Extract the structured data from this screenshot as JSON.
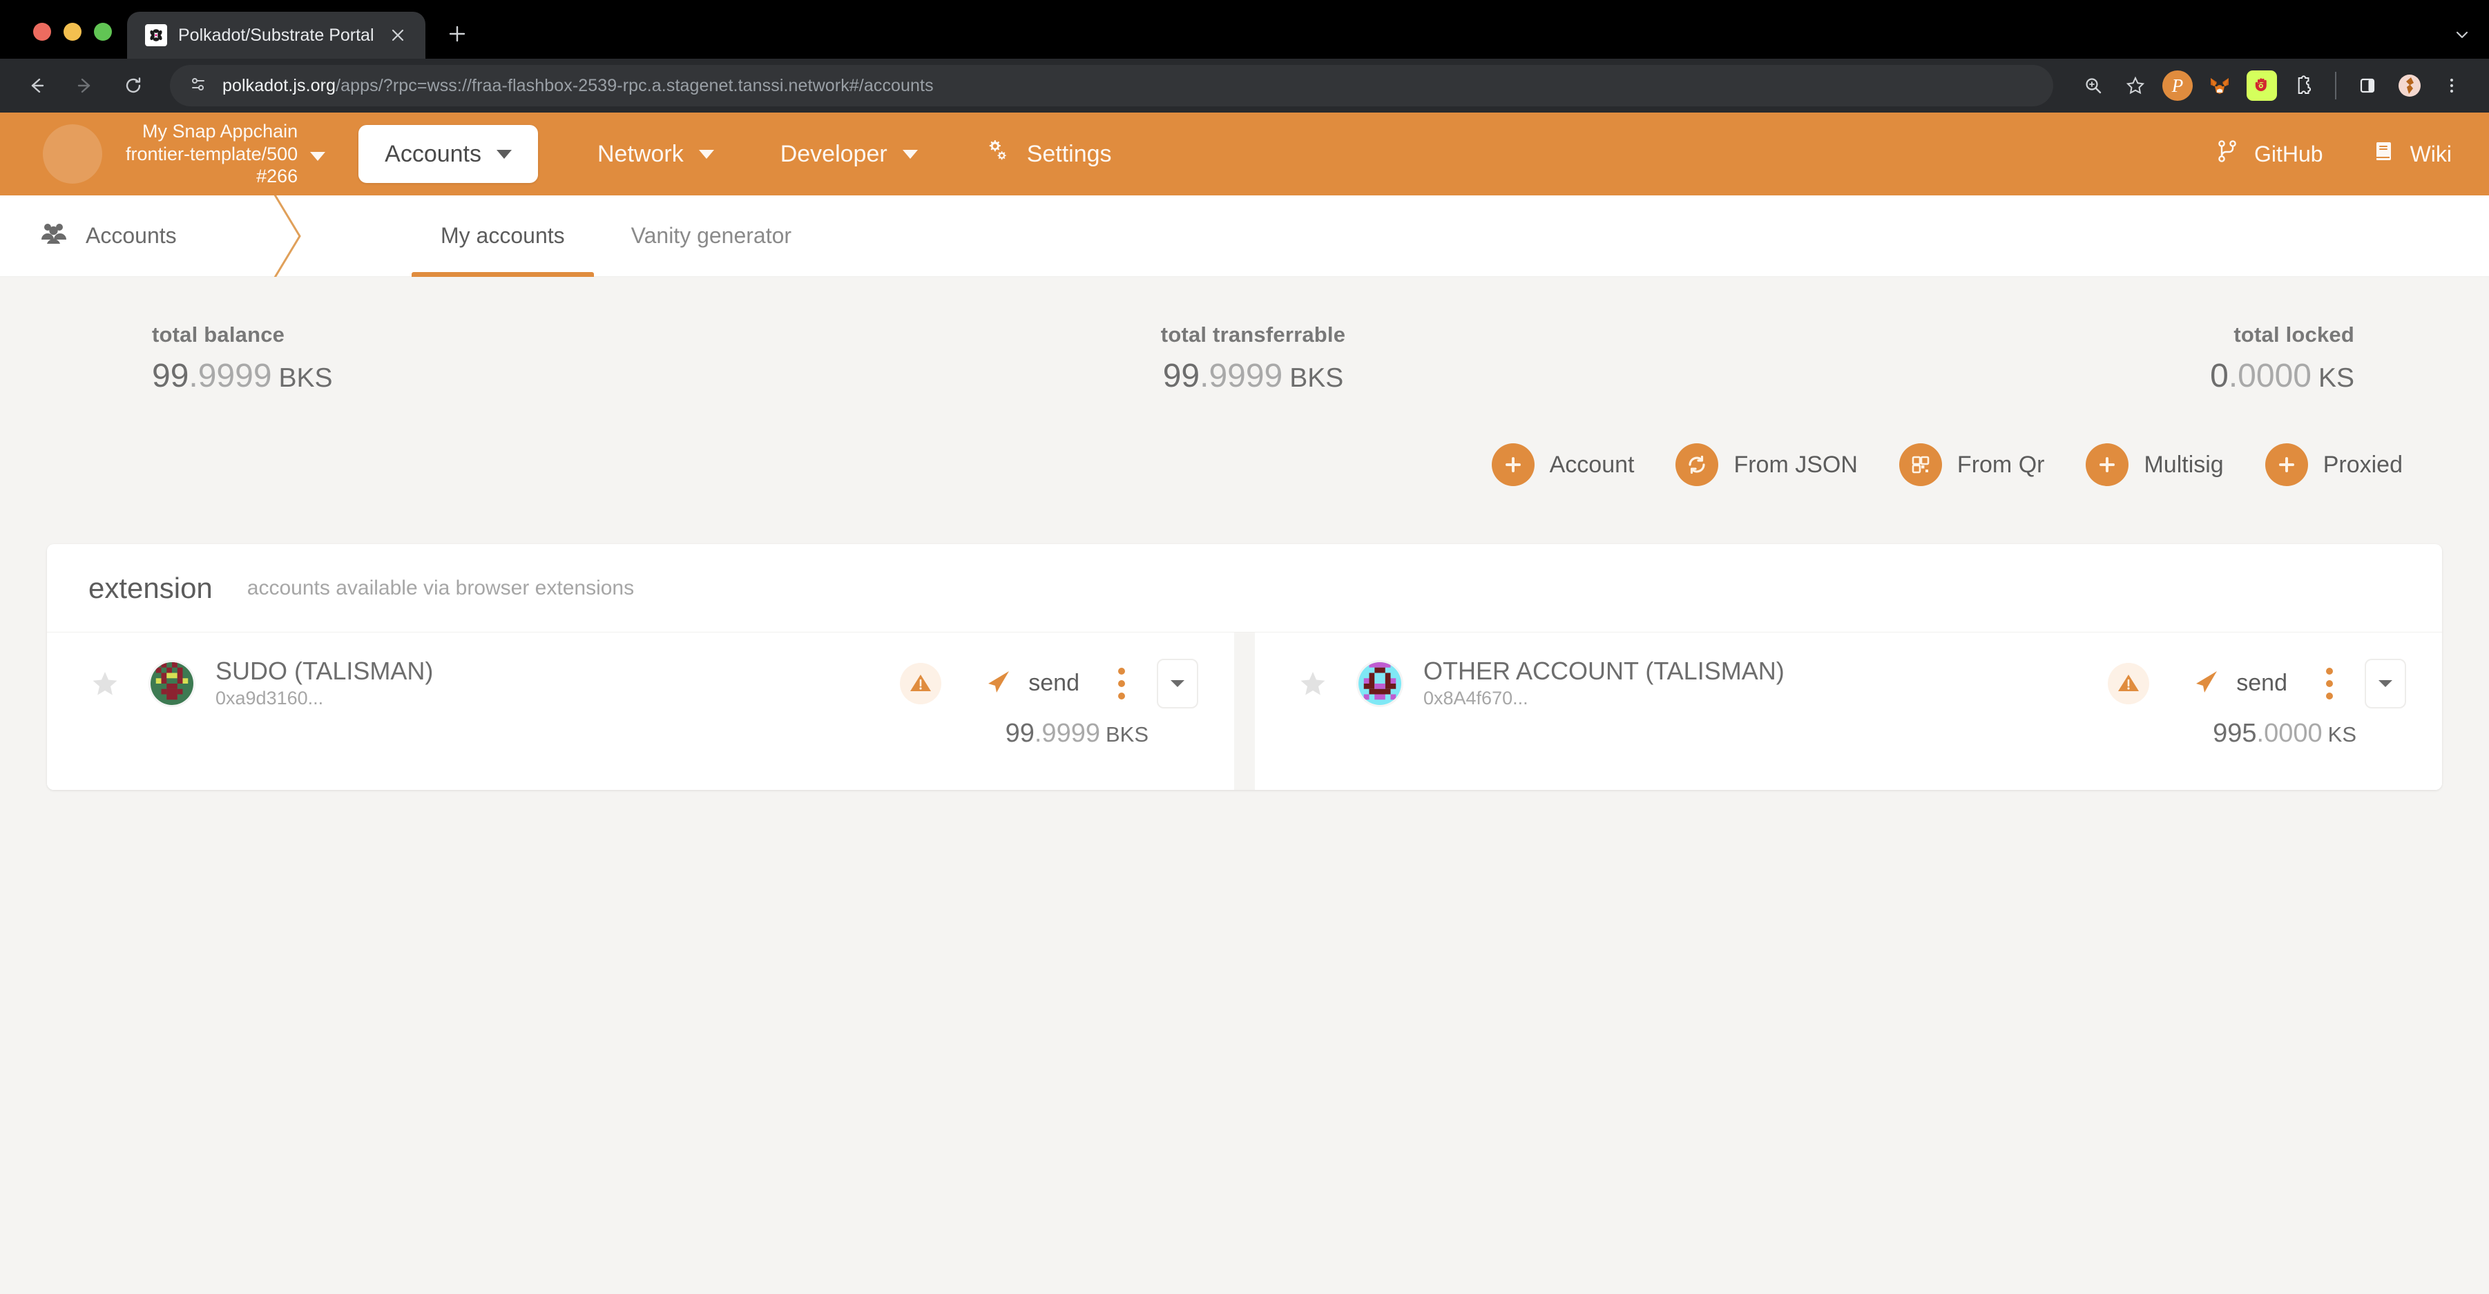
{
  "browser": {
    "tab": {
      "title": "Polkadot/Substrate Portal",
      "favicon_icon": "polkadot-favicon",
      "close_icon": "close-icon"
    },
    "new_tab_icon": "plus-icon",
    "tabstrip_menu_icon": "chevron-down-icon",
    "back_icon": "back-arrow-icon",
    "forward_icon": "forward-arrow-icon",
    "reload_icon": "reload-icon",
    "site_info_icon": "site-settings-icon",
    "url_host": "polkadot.js.org",
    "url_path": "/apps/?rpc=wss://fraa-flashbox-2539-rpc.a.stagenet.tanssi.network#/accounts",
    "toolbar_icons": [
      "zoom-search-icon",
      "bookmark-star-icon",
      "polkadot-extension-icon",
      "metamask-extension-icon",
      "talisman-extension-icon",
      "extensions-puzzle-icon",
      "side-panel-icon",
      "profile-avatar-icon",
      "chrome-menu-icon"
    ]
  },
  "topbar": {
    "chain_logo_icon": "chain-logo",
    "chain_name": "My Snap Appchain",
    "chain_spec": "frontier-template/500",
    "chain_block": "#266",
    "chain_caret_icon": "chevron-down-icon",
    "active_menu": "Accounts",
    "active_menu_caret_icon": "chevron-down-icon",
    "menus": [
      {
        "label": "Network",
        "caret_icon": "chevron-down-icon"
      },
      {
        "label": "Developer",
        "caret_icon": "chevron-down-icon"
      }
    ],
    "settings": {
      "label": "Settings",
      "icon": "gears-icon"
    },
    "links": [
      {
        "label": "GitHub",
        "icon": "git-branch-icon"
      },
      {
        "label": "Wiki",
        "icon": "book-icon"
      }
    ]
  },
  "breadcrumb": {
    "label": "Accounts",
    "icon": "users-icon"
  },
  "tabs": [
    {
      "label": "My accounts",
      "active": true
    },
    {
      "label": "Vanity generator",
      "active": false
    }
  ],
  "summary": [
    {
      "label": "total balance",
      "int": "99",
      "dec": ".9999",
      "unit": "BKS"
    },
    {
      "label": "total transferrable",
      "int": "99",
      "dec": ".9999",
      "unit": "BKS"
    },
    {
      "label": "total locked",
      "int": "0",
      "dec": ".0000",
      "unit": "KS"
    }
  ],
  "actions": [
    {
      "label": "Account",
      "icon": "plus-icon"
    },
    {
      "label": "From JSON",
      "icon": "sync-icon"
    },
    {
      "label": "From Qr",
      "icon": "qr-code-icon"
    },
    {
      "label": "Multisig",
      "icon": "plus-icon"
    },
    {
      "label": "Proxied",
      "icon": "plus-icon"
    }
  ],
  "panel": {
    "title": "extension",
    "subtitle": "accounts available via browser extensions"
  },
  "accounts": [
    {
      "name": "SUDO (TALISMAN)",
      "address": "0xa9d3160...",
      "star_icon": "star-icon",
      "identicon": "identicon-sudo",
      "warning_icon": "warning-triangle-icon",
      "send_label": "send",
      "send_icon": "paper-plane-icon",
      "menu_icon": "kebab-menu-icon",
      "expand_icon": "chevron-down-icon",
      "balance_int": "99",
      "balance_dec": ".9999",
      "balance_unit": "BKS"
    },
    {
      "name": "OTHER ACCOUNT (TALISMAN)",
      "address": "0x8A4f670...",
      "star_icon": "star-icon",
      "identicon": "identicon-other",
      "warning_icon": "warning-triangle-icon",
      "send_label": "send",
      "send_icon": "paper-plane-icon",
      "menu_icon": "kebab-menu-icon",
      "expand_icon": "chevron-down-icon",
      "balance_int": "995",
      "balance_dec": ".0000",
      "balance_unit": "KS"
    }
  ],
  "colors": {
    "brand_orange": "#e08c3e",
    "page_bg": "#f5f4f2",
    "text_dark": "#5c5c5c",
    "text_muted": "#a6a6a6"
  }
}
